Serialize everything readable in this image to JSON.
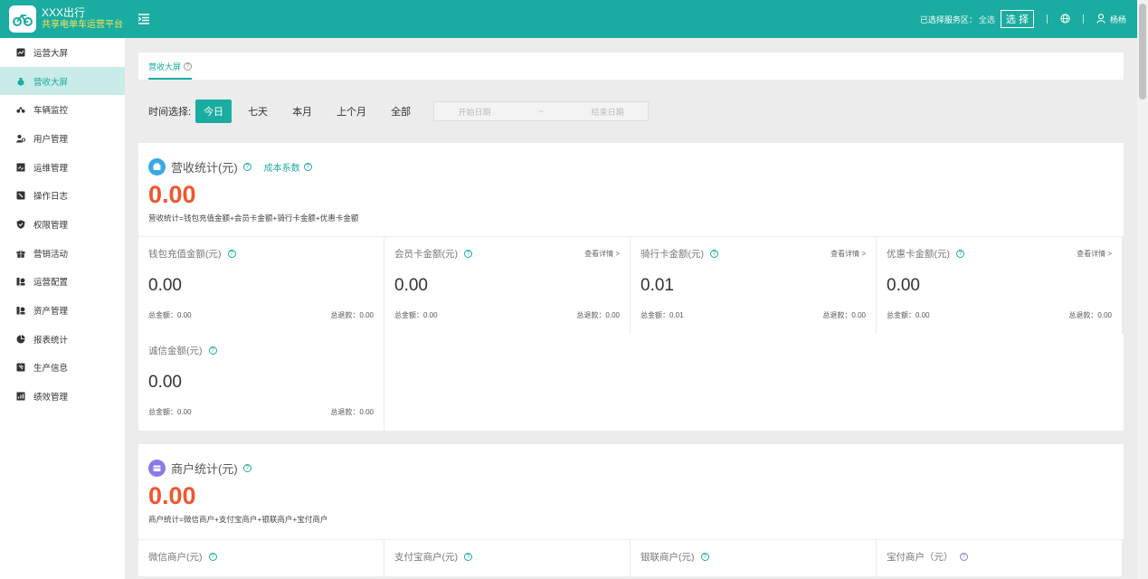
{
  "brand": {
    "name": "XXX出行",
    "subtitle": "共享电单车运营平台"
  },
  "topbar": {
    "service_area_label": "已选择服务区：",
    "service_area_value": "全选",
    "select_button": "选 择",
    "username": "杨杨"
  },
  "sidebar": {
    "items": [
      {
        "label": "运营大屏",
        "icon": "chart-icon"
      },
      {
        "label": "营收大屏",
        "icon": "money-bag-icon"
      },
      {
        "label": "车辆监控",
        "icon": "bike-icon"
      },
      {
        "label": "用户管理",
        "icon": "users-icon"
      },
      {
        "label": "运维管理",
        "icon": "maintenance-icon"
      },
      {
        "label": "操作日志",
        "icon": "log-icon"
      },
      {
        "label": "权限管理",
        "icon": "shield-icon"
      },
      {
        "label": "营销活动",
        "icon": "gift-icon"
      },
      {
        "label": "运营配置",
        "icon": "config-icon"
      },
      {
        "label": "资产管理",
        "icon": "asset-icon"
      },
      {
        "label": "报表统计",
        "icon": "pie-icon"
      },
      {
        "label": "生产信息",
        "icon": "production-icon"
      },
      {
        "label": "绩效管理",
        "icon": "performance-icon"
      }
    ],
    "active_index": 1
  },
  "tab": {
    "label": "营收大屏"
  },
  "time_filter": {
    "label": "时间选择:",
    "options": [
      "今日",
      "七天",
      "本月",
      "上个月",
      "全部"
    ],
    "active": "今日",
    "start_placeholder": "开始日期",
    "separator": "~",
    "end_placeholder": "结束日期"
  },
  "revenue": {
    "title": "营收统计(元)",
    "cost_link": "成本系数",
    "total": "0.00",
    "formula": "营收统计=钱包充值金额+会员卡金额+骑行卡金额+优惠卡金额",
    "cards": [
      {
        "title": "钱包充值金额(元)",
        "detail": "",
        "value": "0.00",
        "total_label": "总金额：0.00",
        "refund_label": "总退款：0.00"
      },
      {
        "title": "会员卡金额(元)",
        "detail": "查看详情 >",
        "value": "0.00",
        "total_label": "总金额：0.00",
        "refund_label": "总退款：0.00"
      },
      {
        "title": "骑行卡金额(元)",
        "detail": "查看详情 >",
        "value": "0.01",
        "total_label": "总金额：0.01",
        "refund_label": "总退款：0.00"
      },
      {
        "title": "优惠卡金额(元)",
        "detail": "查看详情 >",
        "value": "0.00",
        "total_label": "总金额：0.00",
        "refund_label": "总退款：0.00"
      },
      {
        "title": "诚信金额(元)",
        "detail": "",
        "value": "0.00",
        "total_label": "总金额：0.00",
        "refund_label": "总退款：0.00"
      }
    ]
  },
  "merchant": {
    "title": "商户统计(元)",
    "total": "0.00",
    "formula": "商户统计=微信商户+支付宝商户+银联商户+宝付商户",
    "cards": [
      {
        "title": "微信商户(元)"
      },
      {
        "title": "支付宝商户(元)"
      },
      {
        "title": "银联商户(元)"
      },
      {
        "title": "宝付商户（元）"
      }
    ]
  },
  "colors": {
    "primary": "#1aaca0",
    "accent": "#f0562e",
    "brand_sub": "#f5e25c"
  }
}
